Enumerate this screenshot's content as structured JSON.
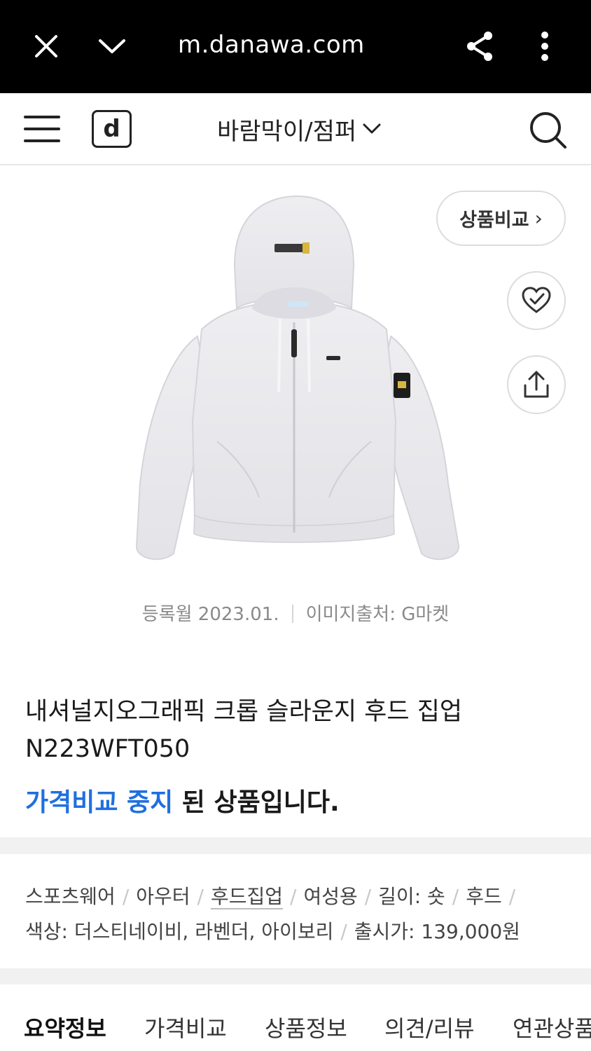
{
  "browser": {
    "url": "m.danawa.com",
    "close_icon": "close-icon",
    "collapse_icon": "chevron-down-icon",
    "share_icon": "share-icon",
    "more_icon": "more-vertical-icon"
  },
  "header": {
    "menu_icon": "hamburger-icon",
    "logo_text": "d",
    "category": "바람막이/점퍼",
    "search_icon": "search-icon"
  },
  "product": {
    "compare_label": "상품비교",
    "compare_arrow": "›",
    "wish_icon": "heart-check-icon",
    "share_icon": "upload-share-icon",
    "registered": "등록월 2023.01.",
    "image_source": "이미지출처: G마켓",
    "title": "내셔널지오그래픽 크롭 슬라운지 후드 집업 N223WFT050",
    "notice_highlight": "가격비교 중지",
    "notice_rest": " 된 상품입니다."
  },
  "specs": {
    "row1": [
      "스포츠웨어",
      "아우터",
      "후드집업",
      "여성용",
      "길이: 숏",
      "후드"
    ],
    "row2": [
      "색상: 더스티네이비, 라벤더, 아이보리",
      "출시가: 139,000원"
    ]
  },
  "tabs": [
    "요약정보",
    "가격비교",
    "상품정보",
    "의견/리뷰",
    "연관상품"
  ],
  "colors": {
    "accent_blue": "#1f6fe0",
    "browser_bar": "#000000",
    "band_gray": "#f1f1f1"
  }
}
